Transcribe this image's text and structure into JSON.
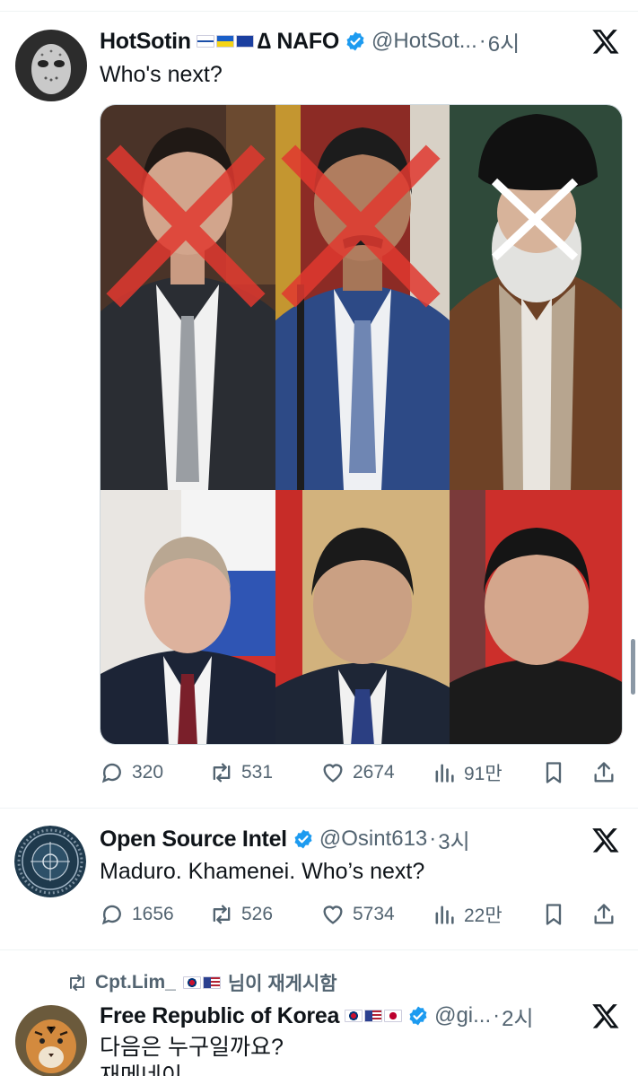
{
  "tweets": [
    {
      "name": "HotSotin",
      "name_suffix": "∆ NAFO",
      "handle": "@HotSot...",
      "time": "6시",
      "text": "Who's next?",
      "replies": "320",
      "reposts": "531",
      "likes": "2674",
      "views": "91만"
    },
    {
      "name": "Open Source Intel",
      "handle": "@Osint613",
      "time": "3시",
      "text": "Maduro. Khamenei. Who’s next?",
      "replies": "1656",
      "reposts": "526",
      "likes": "5734",
      "views": "22만"
    },
    {
      "repost_by": "Cpt.Lim_",
      "repost_suffix": "님이 재게시함",
      "name": "Free Republic of Korea",
      "handle": "@gi...",
      "time": "2시",
      "text_line1": "다음은 누구일까요?",
      "text_line2": "재메네이"
    }
  ],
  "separator": "·",
  "colors": {
    "verified": "#1d9bf0",
    "secondary_text": "#536471",
    "cross_red": "#e0382f",
    "cross_white": "#ffffff"
  },
  "icons": [
    "reply-icon",
    "repost-icon",
    "like-icon",
    "views-icon",
    "bookmark-icon",
    "share-icon",
    "verified-badge-icon",
    "x-logo-icon"
  ]
}
